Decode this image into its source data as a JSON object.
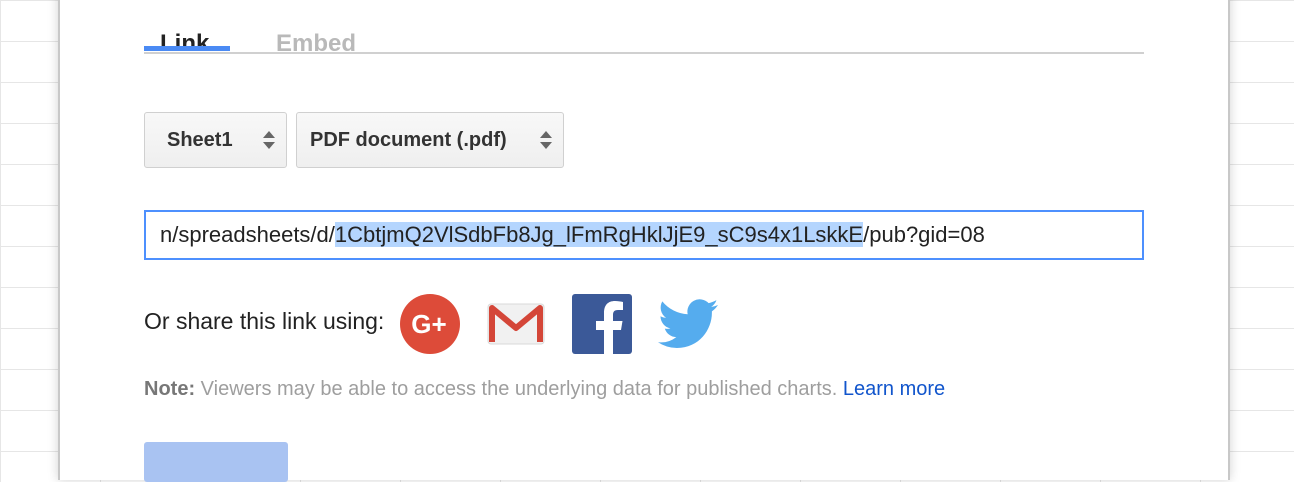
{
  "tabs": [
    {
      "label": "Link",
      "active": true
    },
    {
      "label": "Embed",
      "active": false
    }
  ],
  "selects": {
    "sheet": "Sheet1",
    "format": "PDF document (.pdf)"
  },
  "url": {
    "before": "n/spreadsheets/d/",
    "selected": "1CbtjmQ2VlSdbFb8Jg_lFmRgHklJjE9_sC9s4x1LskkE",
    "after": "/pub?gid=08"
  },
  "share": {
    "label": "Or share this link using:",
    "icons": [
      "google-plus-icon",
      "gmail-icon",
      "facebook-icon",
      "twitter-icon"
    ]
  },
  "note": {
    "prefix": "Note:",
    "text": " Viewers may be able to access the underlying data for published charts. ",
    "link": "Learn more"
  },
  "colors": {
    "accent": "#4a8af4",
    "link": "#1155cc",
    "selection": "#b4d5fe",
    "google_plus": "#dd4b39",
    "facebook": "#3b5998",
    "twitter": "#55acee"
  }
}
